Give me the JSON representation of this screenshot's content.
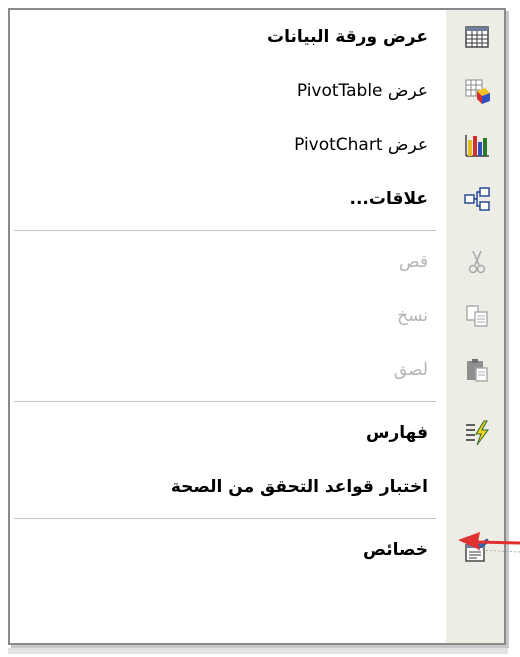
{
  "menu": {
    "items": [
      {
        "label": "عرض ورقة البيانات",
        "icon": "datasheet-view-icon"
      },
      {
        "label": "عرض PivotTable",
        "icon": "pivottable-view-icon"
      },
      {
        "label": "عرض PivotChart",
        "icon": "pivotchart-view-icon"
      },
      {
        "label": "علاقات...",
        "icon": "relationships-icon"
      },
      {
        "label": "قص",
        "icon": "cut-icon",
        "disabled": true
      },
      {
        "label": "نسخ",
        "icon": "copy-icon",
        "disabled": true
      },
      {
        "label": "لصق",
        "icon": "paste-icon",
        "disabled": true
      },
      {
        "label": "فهارس",
        "icon": "indexes-icon"
      },
      {
        "label": "اختبار قواعد التحقق من الصحة",
        "icon": ""
      },
      {
        "label": "خصائص",
        "icon": "properties-icon"
      }
    ]
  },
  "colors": {
    "gutter": "#eeede5",
    "border": "#8a8a8a",
    "disabled_text": "#b4b4b4",
    "pointer_arrow": "#e03030"
  }
}
